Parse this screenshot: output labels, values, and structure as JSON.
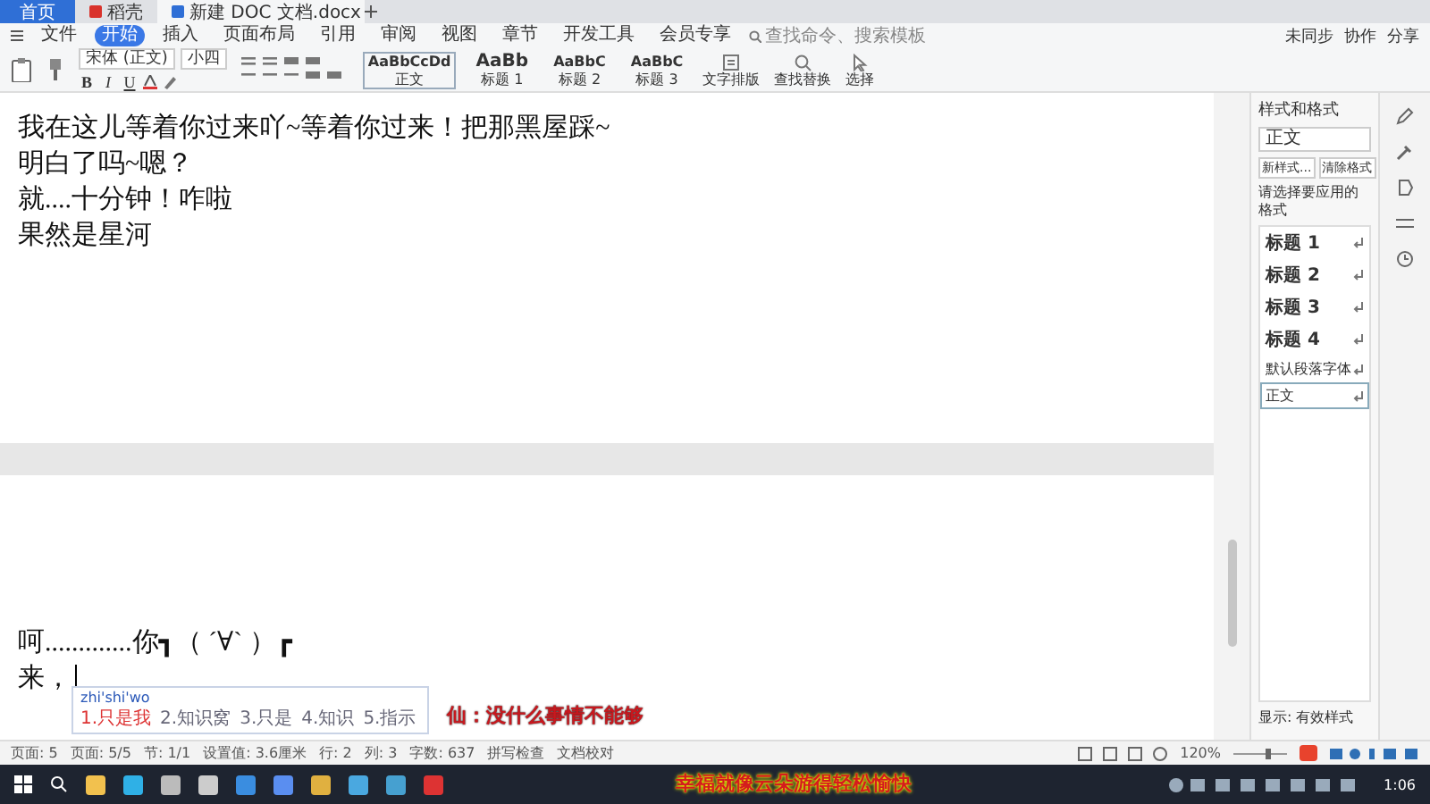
{
  "tabs": [
    {
      "label": "首页",
      "selected": false,
      "kind": "home"
    },
    {
      "label": "稻壳",
      "selected": false,
      "kind": "docer"
    },
    {
      "label": "新建 DOC 文档.docx",
      "selected": true,
      "kind": "doc"
    }
  ],
  "menu": {
    "file": "文件",
    "items": [
      {
        "label": "开始",
        "selected": true
      },
      {
        "label": "插入",
        "selected": false
      },
      {
        "label": "页面布局",
        "selected": false
      },
      {
        "label": "引用",
        "selected": false
      },
      {
        "label": "审阅",
        "selected": false
      },
      {
        "label": "视图",
        "selected": false
      },
      {
        "label": "章节",
        "selected": false
      },
      {
        "label": "开发工具",
        "selected": false
      },
      {
        "label": "会员专享",
        "selected": false
      }
    ],
    "search_placeholder": "查找命令、搜索模板"
  },
  "top_actions": [
    "未同步",
    "协作",
    "分享"
  ],
  "ribbon": {
    "font": "宋体 (正文)",
    "size": "小四",
    "format_buttons": [
      "B",
      "I",
      "U"
    ],
    "styles": [
      {
        "preview": "AaBbCcDd",
        "label": "正文",
        "selected": true
      },
      {
        "preview": "AaBb",
        "label": "标题 1",
        "selected": false
      },
      {
        "preview": "AaBbC",
        "label": "标题 2",
        "selected": false
      },
      {
        "preview": "AaBbC",
        "label": "标题 3",
        "selected": false
      }
    ],
    "tools": [
      {
        "label": "文字排版",
        "kind": "text"
      },
      {
        "label": "查找替换",
        "kind": "search"
      },
      {
        "label": "选择",
        "kind": "select"
      }
    ]
  },
  "document": {
    "pages": [
      {
        "lines": [
          "我在这儿等着你过来吖~等着你过来！把那黑屋踩~",
          "明白了吗~嗯？",
          "就....十分钟！咋啦",
          "果然是星河"
        ],
        "cursor": false
      },
      {
        "lines": [
          "呵.............你┓（ ´∀` ）┏",
          "来，"
        ],
        "cursor": true
      }
    ]
  },
  "ime": {
    "input": "zhi'shi'wo",
    "candidates": [
      {
        "text": "1.只是我",
        "selected": true
      },
      {
        "text": "2.知识窝",
        "selected": false
      },
      {
        "text": "3.只是",
        "selected": false
      },
      {
        "text": "4.知识",
        "selected": false
      },
      {
        "text": "5.指示",
        "selected": false
      }
    ]
  },
  "style_panel": {
    "title": "样式和格式",
    "current": "正文",
    "buttons": [
      "新样式...",
      "清除格式"
    ],
    "prompt": "请选择要应用的格式",
    "styles": [
      {
        "label": "标题 1",
        "kind": "heading",
        "selected": false
      },
      {
        "label": "标题 2",
        "kind": "heading",
        "selected": false
      },
      {
        "label": "标题 3",
        "kind": "heading",
        "selected": false
      },
      {
        "label": "标题 4",
        "kind": "heading",
        "selected": false
      },
      {
        "label": "默认段落字体",
        "kind": "plain",
        "selected": false
      },
      {
        "label": "正文",
        "kind": "plain",
        "selected": true
      }
    ],
    "show": "显示: 有效样式"
  },
  "status_bar": {
    "items": [
      "页面: 5",
      "页面: 5/5",
      "节: 1/1",
      "设置值: 3.6厘米",
      "行: 2",
      "列: 3",
      "字数: 637",
      "拼写检查",
      "文档校对"
    ],
    "zoom": "120%"
  },
  "taskbar": {
    "time": "1:06"
  },
  "captions": [
    "仙：没什么事情不能够",
    "幸福就像云朵游得轻松愉快"
  ]
}
